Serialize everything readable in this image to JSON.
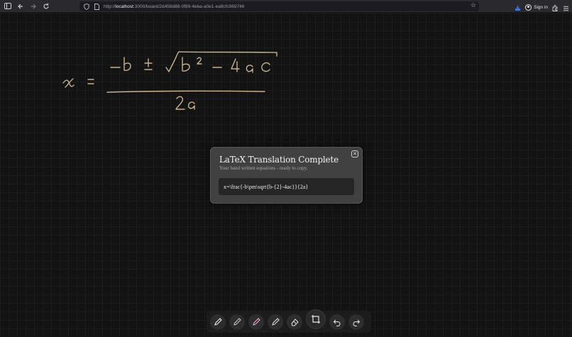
{
  "browser": {
    "url_prefix": "http://",
    "url_host": "localhost",
    "url_rest": ":3000/board/2d458d88-0f99-4eba-a0e1-ea9cfc969746",
    "sign_in_label": "Sign in"
  },
  "canvas": {
    "handwritten_equation": "x = -b ± √b² - 4ac / 2a",
    "ink_color": "#c7b291"
  },
  "modal": {
    "title": "LaTeX Translation Complete",
    "subtitle": "Your hand written equations - ready to copy.",
    "latex": "x=\\frac{-b\\pm\\sqrt{b-{2}-4ac}}{2a}",
    "close_icon": "close-icon"
  },
  "toolbar": {
    "tools": [
      "pen-white-icon",
      "pen-gray-icon",
      "pen-pink-icon",
      "pen-light-icon",
      "eraser-icon",
      "crop-icon",
      "undo-icon",
      "redo-icon"
    ],
    "pen_colors": [
      "#ffffff",
      "#cfcfcf",
      "#f2b8d8",
      "#e6e6e6"
    ]
  }
}
